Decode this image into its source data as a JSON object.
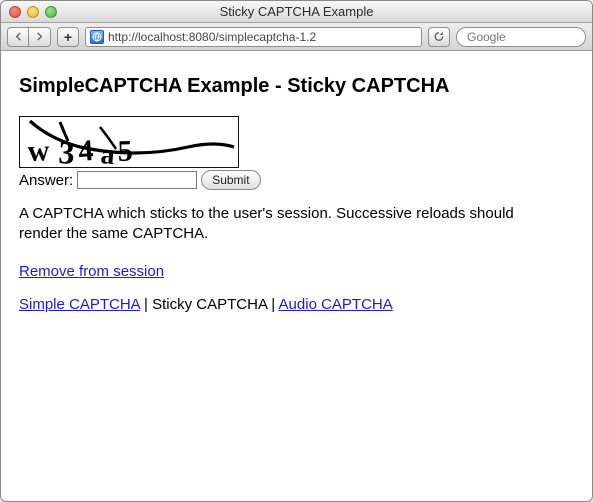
{
  "window": {
    "title": "Sticky CAPTCHA Example"
  },
  "toolbar": {
    "url": "http://localhost:8080/simplecaptcha-1.2",
    "search_placeholder": "Google"
  },
  "page": {
    "heading": "SimpleCAPTCHA Example - Sticky CAPTCHA",
    "captcha_text": "w34a5",
    "answer_label": "Answer:",
    "answer_value": "",
    "submit_label": "Submit",
    "description": "A CAPTCHA which sticks to the user's session. Successive reloads should render the same CAPTCHA.",
    "remove_link": "Remove from session",
    "nav": {
      "simple": "Simple CAPTCHA",
      "sticky": "Sticky CAPTCHA",
      "audio": "Audio CAPTCHA",
      "sep": " | "
    }
  }
}
